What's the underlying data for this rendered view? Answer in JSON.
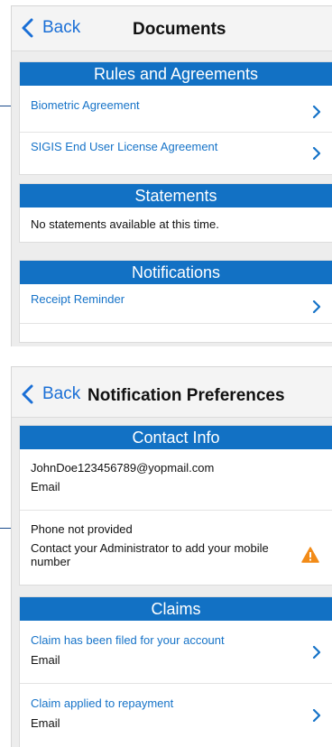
{
  "documents_screen": {
    "back_label": "Back",
    "title": "Documents",
    "rules": {
      "header": "Rules and Agreements",
      "items": [
        {
          "label": "Biometric Agreement"
        },
        {
          "label": "SIGIS End User License Agreement"
        }
      ]
    },
    "statements": {
      "header": "Statements",
      "empty_text": "No statements available at this time."
    },
    "notifications": {
      "header": "Notifications",
      "items": [
        {
          "label": "Receipt Reminder"
        }
      ]
    }
  },
  "notification_prefs_screen": {
    "back_label": "Back",
    "title": "Notification Preferences",
    "contact_info": {
      "header": "Contact Info",
      "email_value": "JohnDoe123456789@yopmail.com",
      "email_type": "Email",
      "phone_value": "Phone not provided",
      "phone_note": "Contact your Administrator to add your mobile number"
    },
    "claims": {
      "header": "Claims",
      "items": [
        {
          "label": "Claim has been filed for your account",
          "channel": "Email"
        },
        {
          "label": "Claim applied to repayment",
          "channel": "Email"
        }
      ]
    }
  },
  "colors": {
    "accent": "#1271c4",
    "link": "#1673c8",
    "warning": "#f28b18"
  },
  "icons": {
    "back": "chevron-left-icon",
    "row_arrow": "chevron-right-icon",
    "warning": "warning-triangle-icon"
  }
}
